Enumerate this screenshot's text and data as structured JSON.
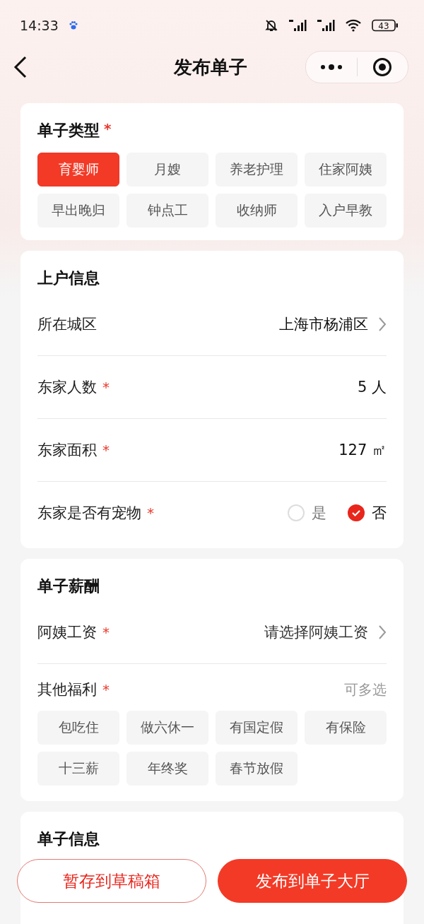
{
  "status_bar": {
    "time": "14:33",
    "battery": "43"
  },
  "nav": {
    "title": "发布单子"
  },
  "type_card": {
    "title": "单子类型",
    "mark": "*",
    "options": [
      {
        "label": "育婴师",
        "selected": true
      },
      {
        "label": "月嫂",
        "selected": false
      },
      {
        "label": "养老护理",
        "selected": false
      },
      {
        "label": "住家阿姨",
        "selected": false
      },
      {
        "label": "早出晚归",
        "selected": false
      },
      {
        "label": "钟点工",
        "selected": false
      },
      {
        "label": "收纳师",
        "selected": false
      },
      {
        "label": "入户早教",
        "selected": false
      }
    ]
  },
  "home_card": {
    "title": "上户信息",
    "rows": [
      {
        "kind": "select",
        "label": "所在城区",
        "value": "上海市杨浦区"
      },
      {
        "kind": "value",
        "label": "东家人数",
        "mark": "*",
        "value": "5 人"
      },
      {
        "kind": "value",
        "label": "东家面积",
        "mark": "*",
        "value": "127 ㎡"
      },
      {
        "kind": "radio",
        "label": "东家是否有宠物",
        "mark": "*",
        "options": [
          {
            "label": "是",
            "selected": false
          },
          {
            "label": "否",
            "selected": true
          }
        ]
      }
    ]
  },
  "pay_card": {
    "title": "单子薪酬",
    "rows": [
      {
        "kind": "select",
        "label": "阿姨工资",
        "mark": "*",
        "placeholder": "请选择阿姨工资"
      }
    ],
    "benefits": {
      "label": "其他福利",
      "mark": "*",
      "hint": "可多选",
      "options": [
        {
          "label": "包吃住",
          "selected": false
        },
        {
          "label": "做六休一",
          "selected": false
        },
        {
          "label": "有国定假",
          "selected": false
        },
        {
          "label": "有保险",
          "selected": false
        },
        {
          "label": "十三薪",
          "selected": false
        },
        {
          "label": "年终奖",
          "selected": false
        },
        {
          "label": "春节放假",
          "selected": false
        }
      ]
    }
  },
  "info_card": {
    "title": "单子信息"
  },
  "buttons": {
    "draft": "暂存到草稿箱",
    "publish": "发布到单子大厅"
  }
}
